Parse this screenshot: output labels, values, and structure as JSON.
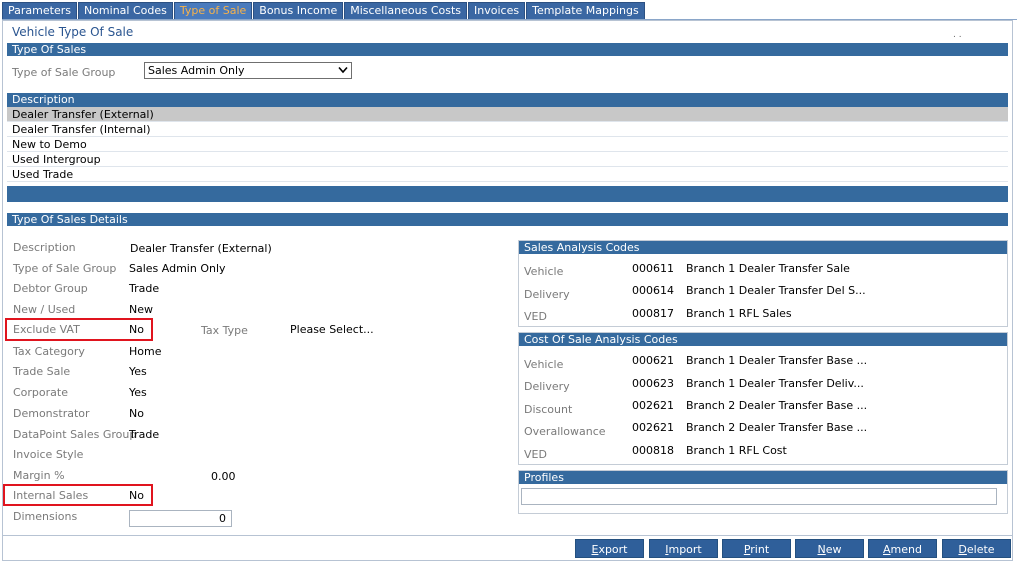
{
  "tabs": [
    "Parameters",
    "Nominal Codes",
    "Type of Sale",
    "Bonus Income",
    "Miscellaneous Costs",
    "Invoices",
    "Template Mappings"
  ],
  "active_tab": "Type of Sale",
  "page_title": "Vehicle Type Of Sale",
  "corner_marks": ". .",
  "type_of_sales": {
    "header": "Type Of Sales",
    "group_label": "Type of Sale Group",
    "group_value": "Sales Admin Only"
  },
  "description_list": {
    "header": "Description",
    "items": [
      "Dealer Transfer (External)",
      "Dealer Transfer (Internal)",
      "New to Demo",
      "Used Intergroup",
      "Used Trade"
    ],
    "selected_index": 0
  },
  "details": {
    "header": "Type Of Sales Details",
    "fields": {
      "description": {
        "label": "Description",
        "value": "Dealer Transfer (External)"
      },
      "type_of_sale_group": {
        "label": "Type of Sale Group",
        "value": "Sales Admin Only"
      },
      "debtor_group": {
        "label": "Debtor Group",
        "value": "Trade"
      },
      "new_used": {
        "label": "New / Used",
        "value": "New"
      },
      "exclude_vat": {
        "label": "Exclude VAT",
        "value": "No"
      },
      "tax_type": {
        "label": "Tax Type",
        "value": "Please Select..."
      },
      "tax_category": {
        "label": "Tax Category",
        "value": "Home"
      },
      "trade_sale": {
        "label": "Trade Sale",
        "value": "Yes"
      },
      "corporate": {
        "label": "Corporate",
        "value": "Yes"
      },
      "demonstrator": {
        "label": "Demonstrator",
        "value": "No"
      },
      "datapoint_sales_group": {
        "label": "DataPoint Sales Group",
        "value": "Trade"
      },
      "invoice_style": {
        "label": "Invoice Style",
        "value": ""
      },
      "margin": {
        "label": "Margin %",
        "value": "0.00"
      },
      "internal_sales": {
        "label": "Internal Sales",
        "value": "No"
      },
      "dimensions": {
        "label": "Dimensions",
        "value": "0"
      }
    }
  },
  "sales_analysis": {
    "header": "Sales Analysis Codes",
    "rows": [
      {
        "label": "Vehicle",
        "code": "000611",
        "desc": "Branch 1 Dealer Transfer Sale"
      },
      {
        "label": "Delivery",
        "code": "000614",
        "desc": "Branch 1 Dealer Transfer Del S..."
      },
      {
        "label": "VED",
        "code": "000817",
        "desc": "Branch 1 RFL Sales"
      }
    ]
  },
  "cost_of_sale": {
    "header": "Cost Of Sale Analysis Codes",
    "rows": [
      {
        "label": "Vehicle",
        "code": "000621",
        "desc": "Branch 1 Dealer Transfer Base ..."
      },
      {
        "label": "Delivery",
        "code": "000623",
        "desc": "Branch 1 Dealer Transfer Deliv..."
      },
      {
        "label": "Discount",
        "code": "002621",
        "desc": "Branch 2 Dealer Transfer Base ..."
      },
      {
        "label": "Overallowance",
        "code": "002621",
        "desc": "Branch 2 Dealer Transfer Base ..."
      },
      {
        "label": "VED",
        "code": "000818",
        "desc": "Branch 1 RFL Cost"
      }
    ]
  },
  "profiles": {
    "header": "Profiles",
    "value": ""
  },
  "buttons": {
    "export": {
      "underline": "E",
      "rest": "xport"
    },
    "import": {
      "underline": "I",
      "rest": "mport"
    },
    "print": {
      "underline": "P",
      "rest": "rint"
    },
    "new": {
      "underline": "N",
      "rest": "ew"
    },
    "amend": {
      "underline": "A",
      "rest": "mend"
    },
    "delete": {
      "underline": "D",
      "rest": "elete"
    }
  },
  "colors": {
    "header_blue": "#356a9e",
    "active_tab_text": "#f7b24a",
    "highlight_red": "#e0141e",
    "title_blue": "#2a5590"
  }
}
